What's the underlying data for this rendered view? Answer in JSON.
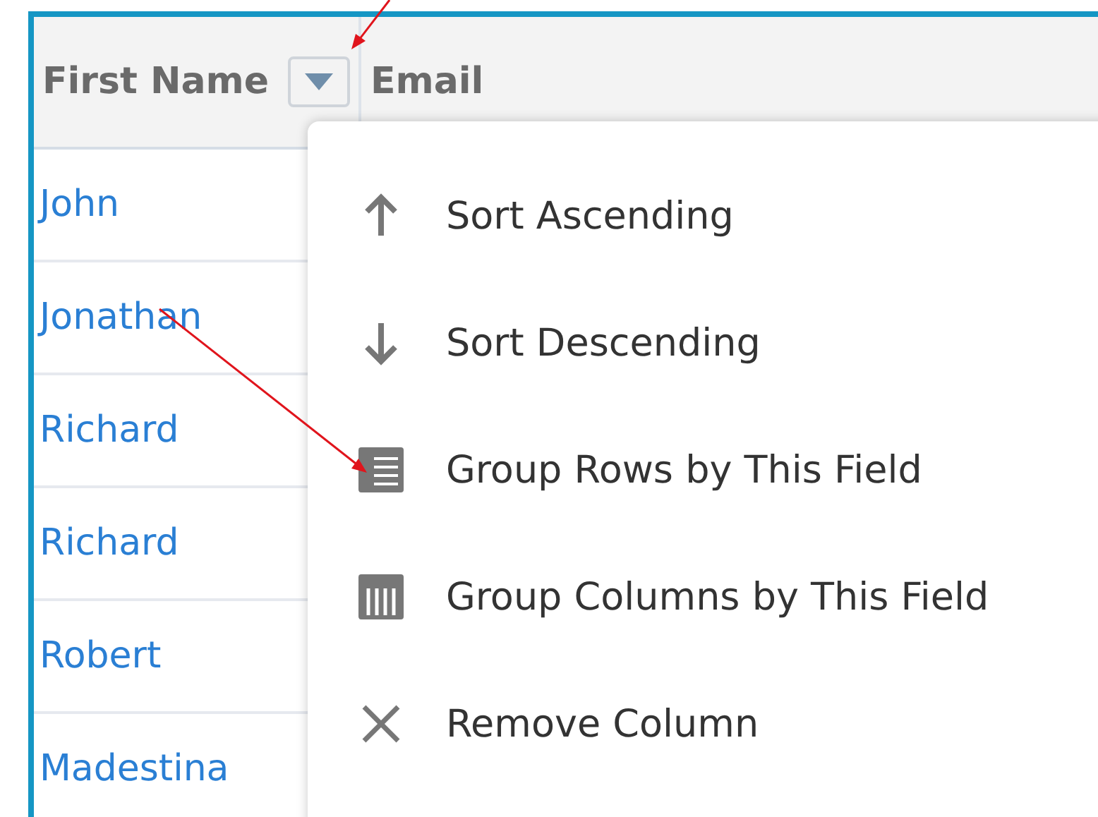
{
  "table": {
    "columns": [
      {
        "label": "First Name",
        "has_menu": true
      },
      {
        "label": "Email",
        "has_menu": false
      }
    ],
    "rows": [
      {
        "first_name": "John"
      },
      {
        "first_name": "Jonathan"
      },
      {
        "first_name": "Richard"
      },
      {
        "first_name": "Richard"
      },
      {
        "first_name": "Robert"
      },
      {
        "first_name": "Madestina"
      }
    ]
  },
  "column_menu": {
    "items": [
      {
        "kind": "sort-up",
        "label": "Sort Ascending"
      },
      {
        "kind": "sort-down",
        "label": "Sort Descending"
      },
      {
        "kind": "group-rows",
        "label": "Group Rows by This Field"
      },
      {
        "kind": "group-columns",
        "label": "Group Columns by This Field"
      },
      {
        "kind": "remove",
        "label": "Remove Column"
      }
    ]
  }
}
